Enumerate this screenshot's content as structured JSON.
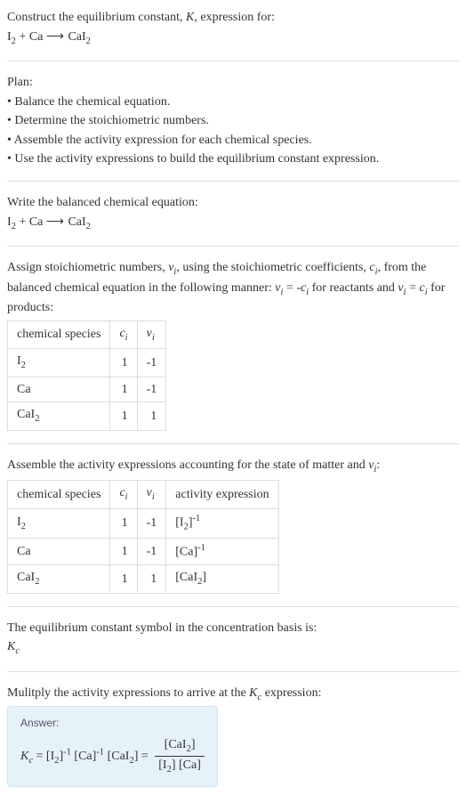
{
  "intro": {
    "line1": "Construct the equilibrium constant, K, expression for:",
    "equation": "I₂ + Ca ⟶ CaI₂"
  },
  "plan": {
    "title": "Plan:",
    "items": [
      "• Balance the chemical equation.",
      "• Determine the stoichiometric numbers.",
      "• Assemble the activity expression for each chemical species.",
      "• Use the activity expressions to build the equilibrium constant expression."
    ]
  },
  "balanced": {
    "line": "Write the balanced chemical equation:",
    "equation": "I₂ + Ca ⟶ CaI₂"
  },
  "assign": {
    "text": "Assign stoichiometric numbers, νᵢ, using the stoichiometric coefficients, cᵢ, from the balanced chemical equation in the following manner: νᵢ = -cᵢ for reactants and νᵢ = cᵢ for products:",
    "headers": {
      "h1": "chemical species",
      "h2": "cᵢ",
      "h3": "νᵢ"
    },
    "rows": [
      {
        "sp": "I₂",
        "c": "1",
        "v": "-1"
      },
      {
        "sp": "Ca",
        "c": "1",
        "v": "-1"
      },
      {
        "sp": "CaI₂",
        "c": "1",
        "v": "1"
      }
    ]
  },
  "activity": {
    "text": "Assemble the activity expressions accounting for the state of matter and νᵢ:",
    "headers": {
      "h1": "chemical species",
      "h2": "cᵢ",
      "h3": "νᵢ",
      "h4": "activity expression"
    },
    "rows": [
      {
        "sp": "I₂",
        "c": "1",
        "v": "-1",
        "a": "[I₂]⁻¹"
      },
      {
        "sp": "Ca",
        "c": "1",
        "v": "-1",
        "a": "[Ca]⁻¹"
      },
      {
        "sp": "CaI₂",
        "c": "1",
        "v": "1",
        "a": "[CaI₂]"
      }
    ]
  },
  "symbol": {
    "line1": "The equilibrium constant symbol in the concentration basis is:",
    "line2": "K_c"
  },
  "multiply": {
    "line": "Mulitply the activity expressions to arrive at the K_c expression:"
  },
  "answer": {
    "label": "Answer:",
    "lhs": "K_c = [I₂]⁻¹ [Ca]⁻¹ [CaI₂] =",
    "num": "[CaI₂]",
    "den": "[I₂] [Ca]"
  },
  "chart_data": {
    "type": "table",
    "tables": [
      {
        "title": "Stoichiometric numbers",
        "columns": [
          "chemical species",
          "c_i",
          "nu_i"
        ],
        "rows": [
          [
            "I2",
            1,
            -1
          ],
          [
            "Ca",
            1,
            -1
          ],
          [
            "CaI2",
            1,
            1
          ]
        ]
      },
      {
        "title": "Activity expressions",
        "columns": [
          "chemical species",
          "c_i",
          "nu_i",
          "activity expression"
        ],
        "rows": [
          [
            "I2",
            1,
            -1,
            "[I2]^-1"
          ],
          [
            "Ca",
            1,
            -1,
            "[Ca]^-1"
          ],
          [
            "CaI2",
            1,
            1,
            "[CaI2]"
          ]
        ]
      }
    ]
  }
}
